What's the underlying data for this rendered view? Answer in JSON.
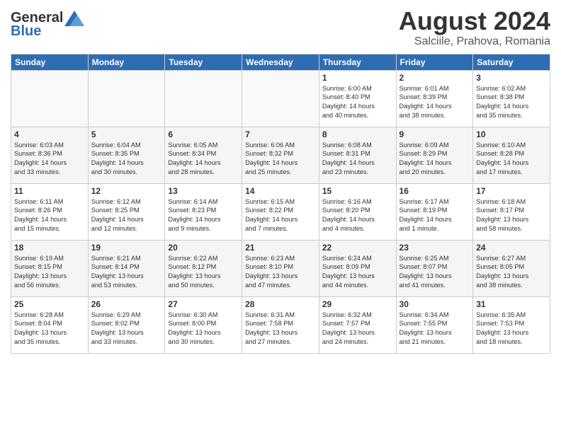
{
  "header": {
    "logo_general": "General",
    "logo_blue": "Blue",
    "month_title": "August 2024",
    "location": "Salciile, Prahova, Romania"
  },
  "days_of_week": [
    "Sunday",
    "Monday",
    "Tuesday",
    "Wednesday",
    "Thursday",
    "Friday",
    "Saturday"
  ],
  "weeks": [
    [
      {
        "day": "",
        "info": ""
      },
      {
        "day": "",
        "info": ""
      },
      {
        "day": "",
        "info": ""
      },
      {
        "day": "",
        "info": ""
      },
      {
        "day": "1",
        "info": "Sunrise: 6:00 AM\nSunset: 8:40 PM\nDaylight: 14 hours\nand 40 minutes."
      },
      {
        "day": "2",
        "info": "Sunrise: 6:01 AM\nSunset: 8:39 PM\nDaylight: 14 hours\nand 38 minutes."
      },
      {
        "day": "3",
        "info": "Sunrise: 6:02 AM\nSunset: 8:38 PM\nDaylight: 14 hours\nand 35 minutes."
      }
    ],
    [
      {
        "day": "4",
        "info": "Sunrise: 6:03 AM\nSunset: 8:36 PM\nDaylight: 14 hours\nand 33 minutes."
      },
      {
        "day": "5",
        "info": "Sunrise: 6:04 AM\nSunset: 8:35 PM\nDaylight: 14 hours\nand 30 minutes."
      },
      {
        "day": "6",
        "info": "Sunrise: 6:05 AM\nSunset: 8:34 PM\nDaylight: 14 hours\nand 28 minutes."
      },
      {
        "day": "7",
        "info": "Sunrise: 6:06 AM\nSunset: 8:32 PM\nDaylight: 14 hours\nand 25 minutes."
      },
      {
        "day": "8",
        "info": "Sunrise: 6:08 AM\nSunset: 8:31 PM\nDaylight: 14 hours\nand 23 minutes."
      },
      {
        "day": "9",
        "info": "Sunrise: 6:09 AM\nSunset: 8:29 PM\nDaylight: 14 hours\nand 20 minutes."
      },
      {
        "day": "10",
        "info": "Sunrise: 6:10 AM\nSunset: 8:28 PM\nDaylight: 14 hours\nand 17 minutes."
      }
    ],
    [
      {
        "day": "11",
        "info": "Sunrise: 6:11 AM\nSunset: 8:26 PM\nDaylight: 14 hours\nand 15 minutes."
      },
      {
        "day": "12",
        "info": "Sunrise: 6:12 AM\nSunset: 8:25 PM\nDaylight: 14 hours\nand 12 minutes."
      },
      {
        "day": "13",
        "info": "Sunrise: 6:14 AM\nSunset: 8:23 PM\nDaylight: 14 hours\nand 9 minutes."
      },
      {
        "day": "14",
        "info": "Sunrise: 6:15 AM\nSunset: 8:22 PM\nDaylight: 14 hours\nand 7 minutes."
      },
      {
        "day": "15",
        "info": "Sunrise: 6:16 AM\nSunset: 8:20 PM\nDaylight: 14 hours\nand 4 minutes."
      },
      {
        "day": "16",
        "info": "Sunrise: 6:17 AM\nSunset: 8:19 PM\nDaylight: 14 hours\nand 1 minute."
      },
      {
        "day": "17",
        "info": "Sunrise: 6:18 AM\nSunset: 8:17 PM\nDaylight: 13 hours\nand 58 minutes."
      }
    ],
    [
      {
        "day": "18",
        "info": "Sunrise: 6:19 AM\nSunset: 8:15 PM\nDaylight: 13 hours\nand 56 minutes."
      },
      {
        "day": "19",
        "info": "Sunrise: 6:21 AM\nSunset: 8:14 PM\nDaylight: 13 hours\nand 53 minutes."
      },
      {
        "day": "20",
        "info": "Sunrise: 6:22 AM\nSunset: 8:12 PM\nDaylight: 13 hours\nand 50 minutes."
      },
      {
        "day": "21",
        "info": "Sunrise: 6:23 AM\nSunset: 8:10 PM\nDaylight: 13 hours\nand 47 minutes."
      },
      {
        "day": "22",
        "info": "Sunrise: 6:24 AM\nSunset: 8:09 PM\nDaylight: 13 hours\nand 44 minutes."
      },
      {
        "day": "23",
        "info": "Sunrise: 6:25 AM\nSunset: 8:07 PM\nDaylight: 13 hours\nand 41 minutes."
      },
      {
        "day": "24",
        "info": "Sunrise: 6:27 AM\nSunset: 8:05 PM\nDaylight: 13 hours\nand 38 minutes."
      }
    ],
    [
      {
        "day": "25",
        "info": "Sunrise: 6:28 AM\nSunset: 8:04 PM\nDaylight: 13 hours\nand 35 minutes."
      },
      {
        "day": "26",
        "info": "Sunrise: 6:29 AM\nSunset: 8:02 PM\nDaylight: 13 hours\nand 33 minutes."
      },
      {
        "day": "27",
        "info": "Sunrise: 6:30 AM\nSunset: 8:00 PM\nDaylight: 13 hours\nand 30 minutes."
      },
      {
        "day": "28",
        "info": "Sunrise: 6:31 AM\nSunset: 7:58 PM\nDaylight: 13 hours\nand 27 minutes."
      },
      {
        "day": "29",
        "info": "Sunrise: 6:32 AM\nSunset: 7:57 PM\nDaylight: 13 hours\nand 24 minutes."
      },
      {
        "day": "30",
        "info": "Sunrise: 6:34 AM\nSunset: 7:55 PM\nDaylight: 13 hours\nand 21 minutes."
      },
      {
        "day": "31",
        "info": "Sunrise: 6:35 AM\nSunset: 7:53 PM\nDaylight: 13 hours\nand 18 minutes."
      }
    ]
  ]
}
